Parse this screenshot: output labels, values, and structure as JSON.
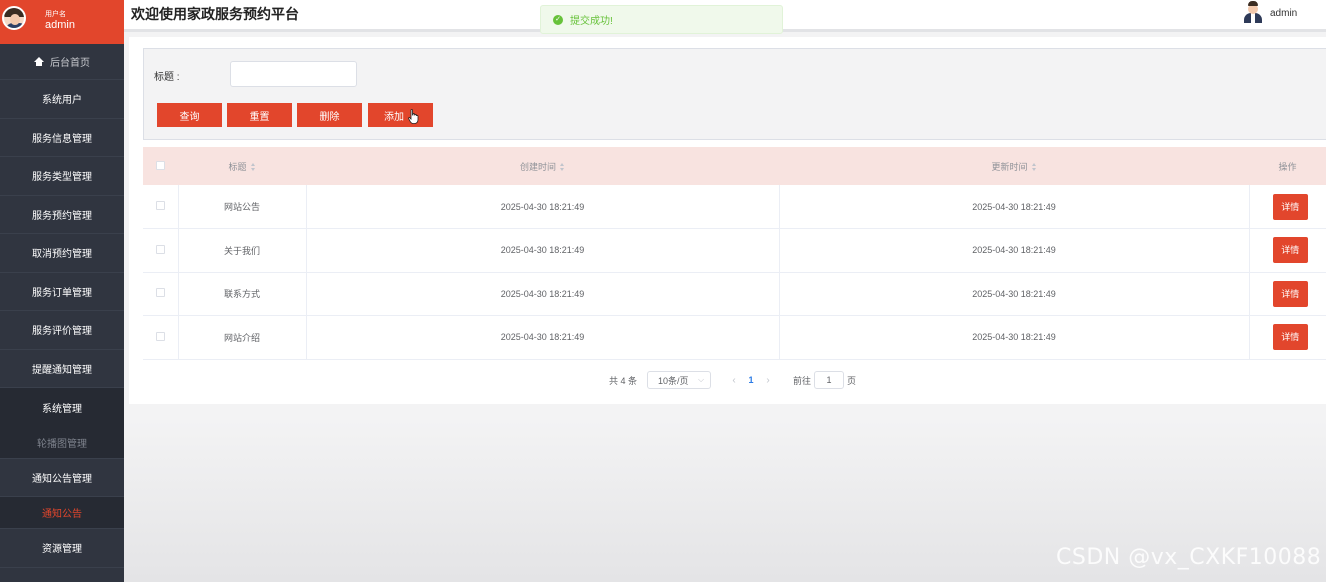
{
  "sidebar": {
    "user_caption": "用户名",
    "user_name": "admin",
    "home": "后台首页",
    "items": [
      {
        "label": "系统用户"
      },
      {
        "label": "服务信息管理"
      },
      {
        "label": "服务类型管理"
      },
      {
        "label": "服务预约管理"
      },
      {
        "label": "取消预约管理"
      },
      {
        "label": "服务订单管理"
      },
      {
        "label": "服务评价管理"
      },
      {
        "label": "提醒通知管理"
      }
    ],
    "system_group": "系统管理",
    "carousel": "轮播图管理",
    "notice_group": "通知公告管理",
    "notice_active": "通知公告",
    "resource": "资源管理"
  },
  "header": {
    "title": "欢迎使用家政服务预约平台",
    "user": "admin"
  },
  "toast": {
    "message": "提交成功!",
    "icon": "success-check-icon"
  },
  "search": {
    "label": "标题 :",
    "value": "",
    "query_label": "查询",
    "reset_label": "重置",
    "delete_label": "删除",
    "add_label": "添加"
  },
  "table": {
    "headers": {
      "title": "标题",
      "created": "创建时间",
      "updated": "更新时间",
      "action": "操作"
    },
    "rows": [
      {
        "title": "网站公告",
        "created": "2025-04-30 18:21:49",
        "updated": "2025-04-30 18:21:49",
        "action": "详情"
      },
      {
        "title": "关于我们",
        "created": "2025-04-30 18:21:49",
        "updated": "2025-04-30 18:21:49",
        "action": "详情"
      },
      {
        "title": "联系方式",
        "created": "2025-04-30 18:21:49",
        "updated": "2025-04-30 18:21:49",
        "action": "详情"
      },
      {
        "title": "网站介绍",
        "created": "2025-04-30 18:21:49",
        "updated": "2025-04-30 18:21:49",
        "action": "详情"
      }
    ]
  },
  "pagination": {
    "total": "共 4 条",
    "page_size": "10条/页",
    "prev": "‹",
    "current": "1",
    "next": "›",
    "goto": "前往",
    "goto_value": "1",
    "page_unit": "页"
  },
  "watermark": "CSDN @vx_CXKF10088",
  "colors": {
    "accent": "#e2462c",
    "sidebar": "#303540",
    "success": "#67c23a",
    "table_header": "#f8e3e0"
  }
}
